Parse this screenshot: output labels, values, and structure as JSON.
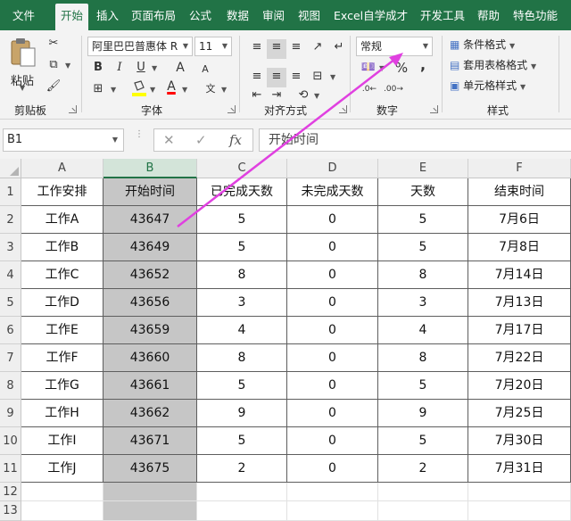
{
  "tabs": [
    "文件",
    "开始",
    "插入",
    "页面布局",
    "公式",
    "数据",
    "审阅",
    "视图",
    "Excel自学成才",
    "开发工具",
    "帮助",
    "特色功能"
  ],
  "ribbon": {
    "clipboard": {
      "paste_label": "粘贴",
      "group_label": "剪贴板"
    },
    "font": {
      "font_name": "阿里巴巴普惠体 R",
      "font_size": "11",
      "bold": "B",
      "italic": "I",
      "underline": "U",
      "grow": "A",
      "shrink": "A",
      "font_color_letter": "A",
      "phonetic": "文",
      "group_label": "字体"
    },
    "alignment": {
      "group_label": "对齐方式"
    },
    "number": {
      "format": "常规",
      "percent": "%",
      "comma": ",",
      "group_label": "数字"
    },
    "styles": {
      "conditional": "条件格式",
      "table": "套用表格格式",
      "cell": "单元格样式",
      "group_label": "样式"
    }
  },
  "formula_bar": {
    "name_box": "B1",
    "cancel": "✕",
    "enter": "✓",
    "fx": "fx",
    "content": "开始时间"
  },
  "columns": [
    "A",
    "B",
    "C",
    "D",
    "E",
    "F"
  ],
  "row_numbers": [
    "1",
    "2",
    "3",
    "4",
    "5",
    "6",
    "7",
    "8",
    "9",
    "10",
    "11",
    "12",
    "13"
  ],
  "table": {
    "headers": [
      "工作安排",
      "开始时间",
      "已完成天数",
      "未完成天数",
      "天数",
      "结束时间"
    ],
    "rows": [
      [
        "工作A",
        "43647",
        "5",
        "0",
        "5",
        "7月6日"
      ],
      [
        "工作B",
        "43649",
        "5",
        "0",
        "5",
        "7月8日"
      ],
      [
        "工作C",
        "43652",
        "8",
        "0",
        "8",
        "7月14日"
      ],
      [
        "工作D",
        "43656",
        "3",
        "0",
        "3",
        "7月13日"
      ],
      [
        "工作E",
        "43659",
        "4",
        "0",
        "4",
        "7月17日"
      ],
      [
        "工作F",
        "43660",
        "8",
        "0",
        "8",
        "7月22日"
      ],
      [
        "工作G",
        "43661",
        "5",
        "0",
        "5",
        "7月20日"
      ],
      [
        "工作H",
        "43662",
        "9",
        "0",
        "9",
        "7月25日"
      ],
      [
        "工作I",
        "43671",
        "5",
        "0",
        "5",
        "7月30日"
      ],
      [
        "工作J",
        "43675",
        "2",
        "0",
        "2",
        "7月31日"
      ]
    ]
  },
  "colors": {
    "excel_green": "#217346",
    "selection_fill": "#c6c6c6",
    "annotation_arrow": "#e040e0"
  }
}
